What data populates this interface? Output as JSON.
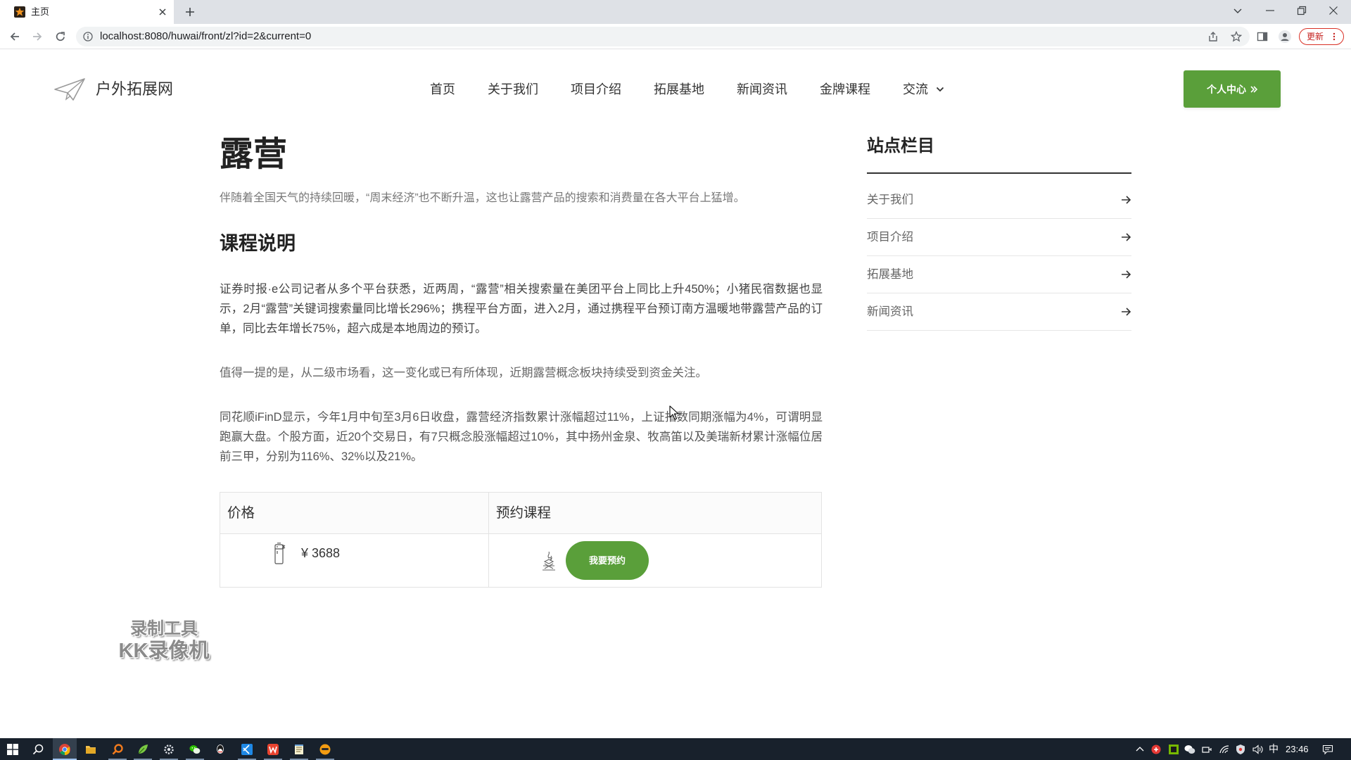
{
  "browser": {
    "tab_title": "主页",
    "url": "localhost:8080/huwai/front/zl?id=2&current=0",
    "update_label": "更新",
    "icons": [
      "site-favicon",
      "tab-close-icon",
      "new-tab-icon",
      "tab-search-chevron-icon",
      "minimize-icon",
      "restore-icon",
      "window-close-icon",
      "back-arrow-icon",
      "forward-arrow-icon",
      "reload-icon",
      "site-info-icon",
      "share-icon",
      "bookmark-star-icon",
      "side-panel-icon",
      "profile-avatar-icon",
      "more-menu-icon"
    ]
  },
  "site": {
    "name": "户外拓展网",
    "nav": [
      "首页",
      "关于我们",
      "项目介绍",
      "拓展基地",
      "新闻资讯",
      "金牌课程",
      "交流"
    ],
    "user_button": "个人中心",
    "icons": [
      "paper-plane-logo-icon",
      "chevron-down-icon",
      "double-chevron-right-icon"
    ]
  },
  "article": {
    "title": "露营",
    "summary": "伴随着全国天气的持续回暖，“周末经济”也不断升温，这也让露营产品的搜索和消费量在各大平台上猛增。",
    "section_heading": "课程说明",
    "paragraphs": [
      "证券时报·e公司记者从多个平台获悉，近两周，“露营”相关搜索量在美团平台上同比上升450%；小猪民宿数据也显示，2月“露营”关键词搜索量同比增长296%；携程平台方面，进入2月，通过携程平台预订南方温暖地带露营产品的订单，同比去年增长75%，超六成是本地周边的预订。",
      "值得一提的是，从二级市场看，这一变化或已有所体现，近期露营概念板块持续受到资金关注。",
      "同花顺iFinD显示，今年1月中旬至3月6日收盘，露营经济指数累计涨幅超过11%，上证指数同期涨幅为4%，可谓明显跑赢大盘。个股方面，近20个交易日，有7只概念股涨幅超过10%，其中扬州金泉、牧高笛以及美瑞新材累计涨幅位居前三甲，分别为116%、32%以及21%。"
    ],
    "table": {
      "headers": [
        "价格",
        "预约课程"
      ],
      "price": "¥ 3688",
      "book_button": "我要预约",
      "icons": [
        "thermos-icon",
        "campfire-icon"
      ]
    }
  },
  "sidebar": {
    "title": "站点栏目",
    "items": [
      "关于我们",
      "项目介绍",
      "拓展基地",
      "新闻资讯"
    ],
    "item_icon": "arrow-right-icon"
  },
  "watermark": {
    "line1": "录制工具",
    "line2": "KK录像机"
  },
  "taskbar": {
    "apps": [
      "windows-start-icon",
      "search-icon",
      "chrome-icon",
      "file-explorer-icon",
      "everything-search-icon",
      "leaf-app-icon",
      "settings-gear-icon",
      "wechat-icon",
      "qq-icon",
      "vscode-icon",
      "wps-icon",
      "notepad-icon",
      "media-app-icon"
    ],
    "tray_icons": [
      "show-hidden-icons-chevron",
      "antivirus-icon",
      "nvidia-icon",
      "wechat-tray-icon",
      "network-device-icon",
      "wifi-icon",
      "shield-tray-icon",
      "volume-icon",
      "notification-icon"
    ],
    "ime_indicator": "中",
    "clock": "23:46"
  },
  "colors": {
    "accent_green": "#5a9f3a",
    "taskbar_bg": "#18212c",
    "update_red": "#d93025",
    "heading_text": "#222222",
    "muted_text": "#666666"
  }
}
